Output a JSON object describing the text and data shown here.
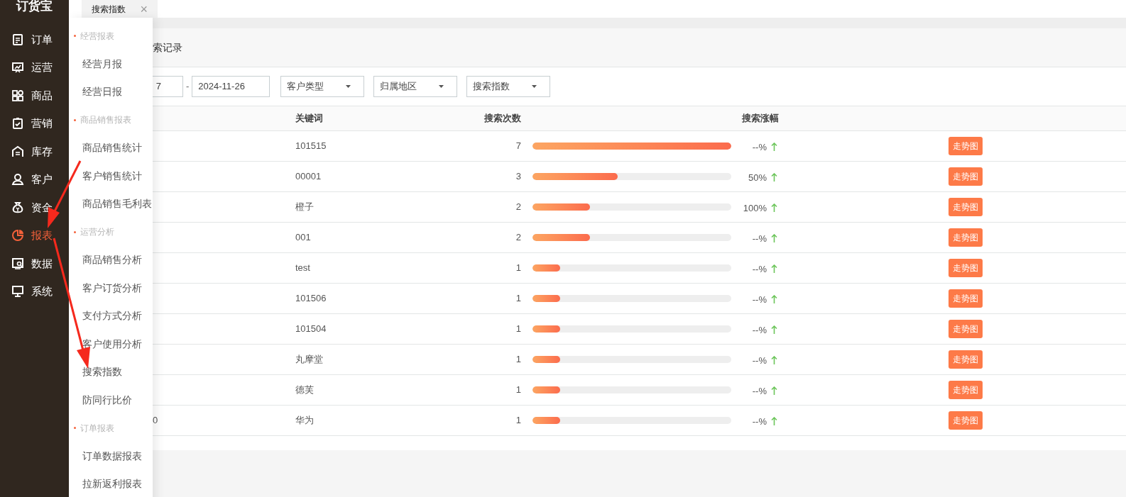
{
  "logo": "订货宝",
  "sidebar": {
    "items": [
      {
        "label": "订单",
        "selected": false
      },
      {
        "label": "运营",
        "selected": false
      },
      {
        "label": "商品",
        "selected": false
      },
      {
        "label": "营销",
        "selected": false
      },
      {
        "label": "库存",
        "selected": false
      },
      {
        "label": "客户",
        "selected": false
      },
      {
        "label": "资金",
        "selected": false
      },
      {
        "label": "报表",
        "selected": true
      },
      {
        "label": "数据",
        "selected": false
      },
      {
        "label": "系统",
        "selected": false
      }
    ]
  },
  "flyout": [
    {
      "kind": "section",
      "label": "经营报表"
    },
    {
      "kind": "item",
      "label": "经营月报"
    },
    {
      "kind": "item",
      "label": "经营日报"
    },
    {
      "kind": "section",
      "label": "商品销售报表"
    },
    {
      "kind": "item",
      "label": "商品销售统计"
    },
    {
      "kind": "item",
      "label": "客户销售统计"
    },
    {
      "kind": "item",
      "label": "商品销售毛利表"
    },
    {
      "kind": "section",
      "label": "运营分析"
    },
    {
      "kind": "item",
      "label": "商品销售分析"
    },
    {
      "kind": "item",
      "label": "客户订货分析"
    },
    {
      "kind": "item",
      "label": "支付方式分析"
    },
    {
      "kind": "item",
      "label": "客户使用分析"
    },
    {
      "kind": "item",
      "label": "搜索指数"
    },
    {
      "kind": "item",
      "label": "防同行比价"
    },
    {
      "kind": "section",
      "label": "订单报表"
    },
    {
      "kind": "item",
      "label": "订单数据报表"
    },
    {
      "kind": "item",
      "label": "拉新返利报表"
    }
  ],
  "tabs": [
    {
      "label": "搜索指数",
      "close": "×",
      "selected": true
    }
  ],
  "page_title": "索记录",
  "filters": {
    "date_start": "7",
    "date_separator": "-",
    "date_end": "2024-11-26",
    "selects": [
      "客户类型",
      "归属地区",
      "搜索指数"
    ]
  },
  "table": {
    "columns": [
      "关键词",
      "搜索次数",
      "搜索涨幅"
    ],
    "rows": [
      {
        "keyword": "101515",
        "count": "7",
        "level": 1,
        "growth": "--%",
        "action": "走势图"
      },
      {
        "keyword": "00001",
        "count": "3",
        "level": 0.43,
        "growth": "50%",
        "action": "走势图"
      },
      {
        "keyword": "橙子",
        "count": "2",
        "level": 0.29,
        "growth": "100%",
        "action": "走势图"
      },
      {
        "keyword": "001",
        "count": "2",
        "level": 0.29,
        "growth": "--%",
        "action": "走势图"
      },
      {
        "keyword": "test",
        "count": "1",
        "level": 0.14,
        "growth": "--%",
        "action": "走势图"
      },
      {
        "keyword": "101506",
        "count": "1",
        "level": 0.14,
        "growth": "--%",
        "action": "走势图"
      },
      {
        "keyword": "101504",
        "count": "1",
        "level": 0.14,
        "growth": "--%",
        "action": "走势图"
      },
      {
        "keyword": "丸摩堂",
        "count": "1",
        "level": 0.14,
        "growth": "--%",
        "action": "走势图"
      },
      {
        "keyword": "德芙",
        "count": "1",
        "level": 0.14,
        "growth": "--%",
        "action": "走势图"
      },
      {
        "column_1": "0",
        "keyword": "华为",
        "count": "1",
        "level": 0.14,
        "growth": "--%",
        "action": "走势图"
      }
    ]
  }
}
